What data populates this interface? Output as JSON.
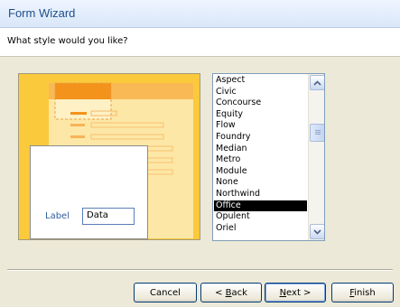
{
  "window": {
    "title": "Form Wizard"
  },
  "header": {
    "question": "What style would you like?"
  },
  "preview": {
    "label_text": "Label",
    "data_text": "Data"
  },
  "styles": {
    "items": [
      "Aspect",
      "Civic",
      "Concourse",
      "Equity",
      "Flow",
      "Foundry",
      "Median",
      "Metro",
      "Module",
      "None",
      "Northwind",
      "Office",
      "Opulent",
      "Oriel"
    ],
    "selected": "Office"
  },
  "buttons": {
    "cancel": "Cancel",
    "back_prefix": "< ",
    "back_ul": "B",
    "back_rest": "ack",
    "next_ul": "N",
    "next_rest": "ext >",
    "finish_ul": "F",
    "finish_rest": "inish"
  },
  "icons": {
    "scroll_up": "scroll-up-arrow-icon",
    "scroll_down": "scroll-down-arrow-icon"
  },
  "colors": {
    "preview_background": "#fbc93c",
    "selection": "#000000",
    "title": "#1f4e8c"
  }
}
